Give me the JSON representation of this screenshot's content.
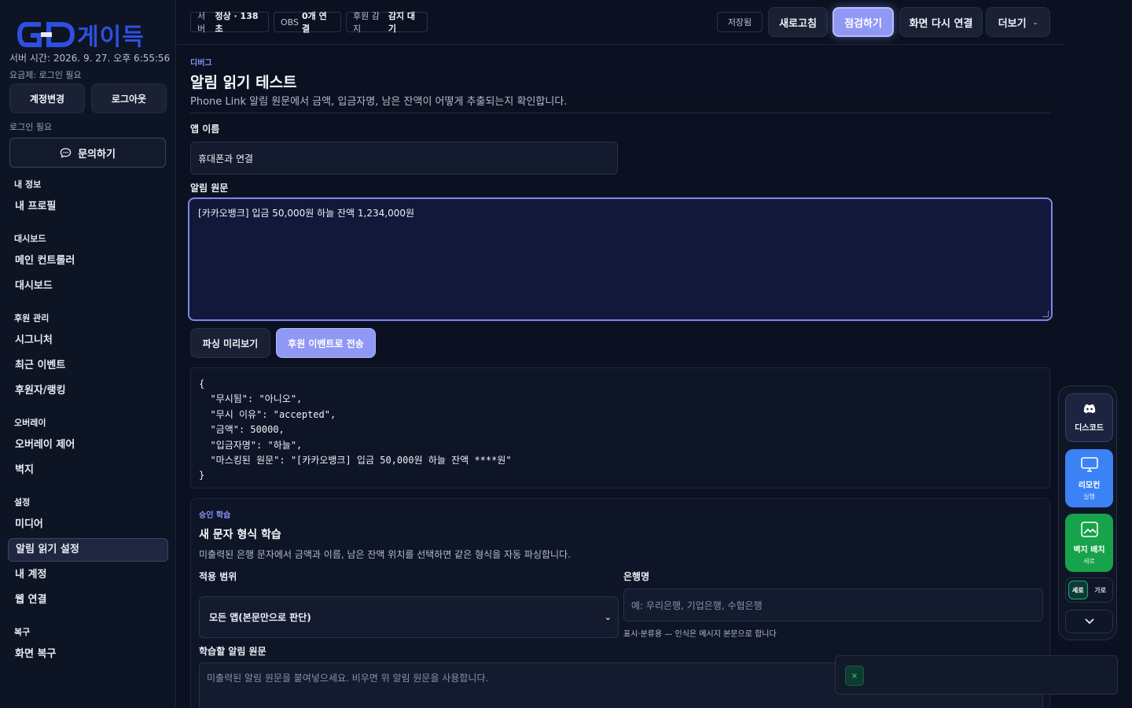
{
  "sidebar": {
    "brand": "게이득",
    "server_time": "서버 시간: 2026. 9. 27. 오후 6:55:56",
    "plan": "요금제: 로그인 필요",
    "account_change": "계정변경",
    "logout": "로그아웃",
    "login_needed": "로그인 필요",
    "inquiry": "문의하기",
    "sections": [
      {
        "title": "내 정보",
        "items": [
          "내 프로필"
        ]
      },
      {
        "title": "대시보드",
        "items": [
          "메인 컨트롤러",
          "대시보드"
        ]
      },
      {
        "title": "후원 관리",
        "items": [
          "시그니처",
          "최근 이벤트",
          "후원자/랭킹"
        ]
      },
      {
        "title": "오버레이",
        "items": [
          "오버레이 제어",
          "벽지"
        ]
      },
      {
        "title": "설정",
        "items": [
          "미디어",
          "알림 읽기 설정",
          "내 계정",
          "웹 연결"
        ]
      },
      {
        "title": "복구",
        "items": [
          "화면 복구"
        ]
      }
    ],
    "active_item": "알림 읽기 설정"
  },
  "topbar": {
    "server_label": "서버",
    "server_value": "정상 · 138초",
    "obs_label": "OBS",
    "obs_value": "0개 연결",
    "donation_label": "후원 감지",
    "donation_value": "감지 대기",
    "saved": "저장됨",
    "refresh": "새로고침",
    "inspect": "점검하기",
    "reconnect": "화면 다시 연결",
    "more": "더보기"
  },
  "main": {
    "eyebrow": "디버그",
    "title": "알림 읽기 테스트",
    "description": "Phone Link 알림 원문에서 금액, 입금자명, 남은 잔액이 어떻게 추출되는지 확인합니다.",
    "app_name_label": "앱 이름",
    "app_name_value": "휴대폰과 연결",
    "raw_label": "알림 원문",
    "raw_value": "[카카오뱅크] 입금 50,000원 하늘 잔액 1,234,000원",
    "parse_preview": "파싱 미리보기",
    "send_event": "후원 이벤트로 전송",
    "json_output": "{\n  \"무시됨\": \"아니오\",\n  \"무시 이유\": \"accepted\",\n  \"금액\": 50000,\n  \"입금자명\": \"하늘\",\n  \"마스킹된 원문\": \"[카카오뱅크] 입금 50,000원 하늘 잔액 ****원\"\n}"
  },
  "learn": {
    "eyebrow": "승인 학습",
    "title": "새 문자 형식 학습",
    "description": "미출력된 은행 문자에서 금액과 이름, 남은 잔액 위치를 선택하면 같은 형식을 자동 파싱합니다.",
    "scope_label": "적용 범위",
    "scope_value": "모든 앱(본문만으로 판단)",
    "bank_label": "은행명",
    "bank_placeholder": "예: 우리은행, 기업은행, 수협은행",
    "bank_hint": "표시·분류용 — 인식은 메시지 본문으로 합니다",
    "raw_learn_label": "학습할 알림 원문",
    "raw_learn_placeholder": "미출력된 알림 원문을 붙여넣으세요. 비우면 위 알림 원문을 사용합니다."
  },
  "dock": {
    "discord": "디스코드",
    "remote": "리모컨",
    "remote_sub": "실행",
    "wallpaper": "벽지 배치",
    "wallpaper_sub": "세로",
    "vertical": "세로",
    "horizontal": "가로"
  },
  "toast": {
    "close": "×"
  },
  "colors": {
    "accent": "#8f98f5",
    "brand": "#2f4fe0",
    "remote": "#3b82f6",
    "wallpaper": "#16a34a"
  }
}
